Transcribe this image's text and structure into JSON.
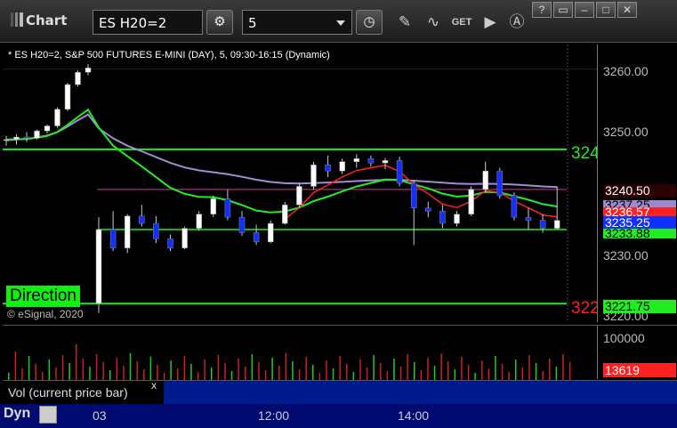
{
  "toolbar": {
    "app_title": "Chart",
    "symbol": "ES H20=2",
    "interval": "5",
    "tools": [
      "gear-icon",
      "clock-icon",
      "pencil-icon",
      "studies-icon",
      "get-icon",
      "play-icon",
      "a-icon"
    ],
    "window_buttons": [
      "?",
      "▭",
      "–",
      "□",
      "✕"
    ]
  },
  "chart": {
    "description": "* ES H20=2, S&P 500 FUTURES E-MINI (DAY), 5, 09:30-16:15 (Dynamic)",
    "copyright": "© eSignal, 2020",
    "direction_label": "Direction",
    "line_label_upper": "324",
    "line_label_lower": "322"
  },
  "price_scale": {
    "ticks": [
      "3260.00",
      "3250.00",
      "3230.00",
      "3220.00"
    ],
    "markers": [
      {
        "text": "3240.50",
        "bg": "#2a0000",
        "fg": "#ffffff"
      },
      {
        "text": "3237.25",
        "bg": "#9a8ad0",
        "fg": "#000000"
      },
      {
        "text": "3236.57",
        "bg": "#ff2020",
        "fg": "#ffffff"
      },
      {
        "text": "3235.25",
        "bg": "#1030ff",
        "fg": "#ffffff"
      },
      {
        "text": "3233.88",
        "bg": "#20ee20",
        "fg": "#000000"
      },
      {
        "text": "3221.75",
        "bg": "#20ee20",
        "fg": "#000000"
      }
    ]
  },
  "volume": {
    "label": "Vol (current price bar)",
    "close": "x",
    "tick": "100000",
    "current": "13619"
  },
  "time_axis": {
    "mode": "Dyn",
    "labels": [
      "03",
      "12:00",
      "14:00"
    ]
  },
  "chart_data": {
    "type": "candlestick",
    "ylim": [
      3219,
      3264
    ],
    "levels": {
      "upper_resistance": 3247,
      "lower_support": 3222,
      "purple_line": 3240.5
    },
    "candles": [
      [
        3248.5,
        3249.2,
        3247.6,
        3248.6
      ],
      [
        3248.6,
        3249.4,
        3247.8,
        3249.0
      ],
      [
        3249.0,
        3249.8,
        3248.2,
        3248.8
      ],
      [
        3248.8,
        3250.2,
        3248.6,
        3250.0
      ],
      [
        3250.0,
        3251.0,
        3249.6,
        3250.8
      ],
      [
        3250.8,
        3253.8,
        3250.5,
        3253.5
      ],
      [
        3253.5,
        3257.8,
        3253.2,
        3257.5
      ],
      [
        3257.5,
        3259.8,
        3257.2,
        3259.5
      ],
      [
        3259.5,
        3260.8,
        3259.0,
        3260.2
      ],
      [
        3222.0,
        3236.0,
        3220.5,
        3234.0
      ],
      [
        3234.0,
        3237.0,
        3230.5,
        3231.0
      ],
      [
        3231.0,
        3236.5,
        3230.2,
        3236.2
      ],
      [
        3236.2,
        3238.0,
        3234.5,
        3235.0
      ],
      [
        3235.0,
        3236.2,
        3231.8,
        3232.5
      ],
      [
        3232.5,
        3233.2,
        3230.5,
        3231.0
      ],
      [
        3231.0,
        3234.5,
        3230.8,
        3234.2
      ],
      [
        3234.2,
        3237.0,
        3233.8,
        3236.5
      ],
      [
        3236.5,
        3239.5,
        3236.0,
        3239.0
      ],
      [
        3239.0,
        3240.5,
        3235.5,
        3236.0
      ],
      [
        3236.0,
        3237.0,
        3233.0,
        3233.5
      ],
      [
        3233.5,
        3234.8,
        3231.5,
        3232.0
      ],
      [
        3232.0,
        3235.5,
        3231.8,
        3235.0
      ],
      [
        3235.0,
        3238.5,
        3234.8,
        3238.0
      ],
      [
        3238.0,
        3241.5,
        3237.5,
        3241.0
      ],
      [
        3241.0,
        3245.0,
        3240.5,
        3244.5
      ],
      [
        3244.5,
        3246.0,
        3242.5,
        3243.5
      ],
      [
        3243.5,
        3245.5,
        3243.0,
        3245.0
      ],
      [
        3245.0,
        3246.2,
        3244.0,
        3245.5
      ],
      [
        3245.5,
        3246.0,
        3244.2,
        3244.8
      ],
      [
        3244.8,
        3245.6,
        3243.8,
        3245.2
      ],
      [
        3245.2,
        3245.8,
        3241.0,
        3241.5
      ],
      [
        3241.5,
        3242.0,
        3231.5,
        3237.5
      ],
      [
        3237.5,
        3238.5,
        3236.0,
        3237.0
      ],
      [
        3237.0,
        3238.0,
        3234.2,
        3235.0
      ],
      [
        3235.0,
        3237.0,
        3234.5,
        3236.5
      ],
      [
        3236.5,
        3241.0,
        3236.2,
        3240.5
      ],
      [
        3240.5,
        3245.0,
        3240.0,
        3243.5
      ],
      [
        3243.5,
        3244.0,
        3239.0,
        3239.5
      ],
      [
        3239.5,
        3240.0,
        3235.5,
        3236.0
      ],
      [
        3236.0,
        3237.5,
        3234.0,
        3235.5
      ],
      [
        3235.5,
        3236.5,
        3233.5,
        3234.2
      ],
      [
        3234.2,
        3241.0,
        3234.0,
        3235.5
      ]
    ]
  }
}
